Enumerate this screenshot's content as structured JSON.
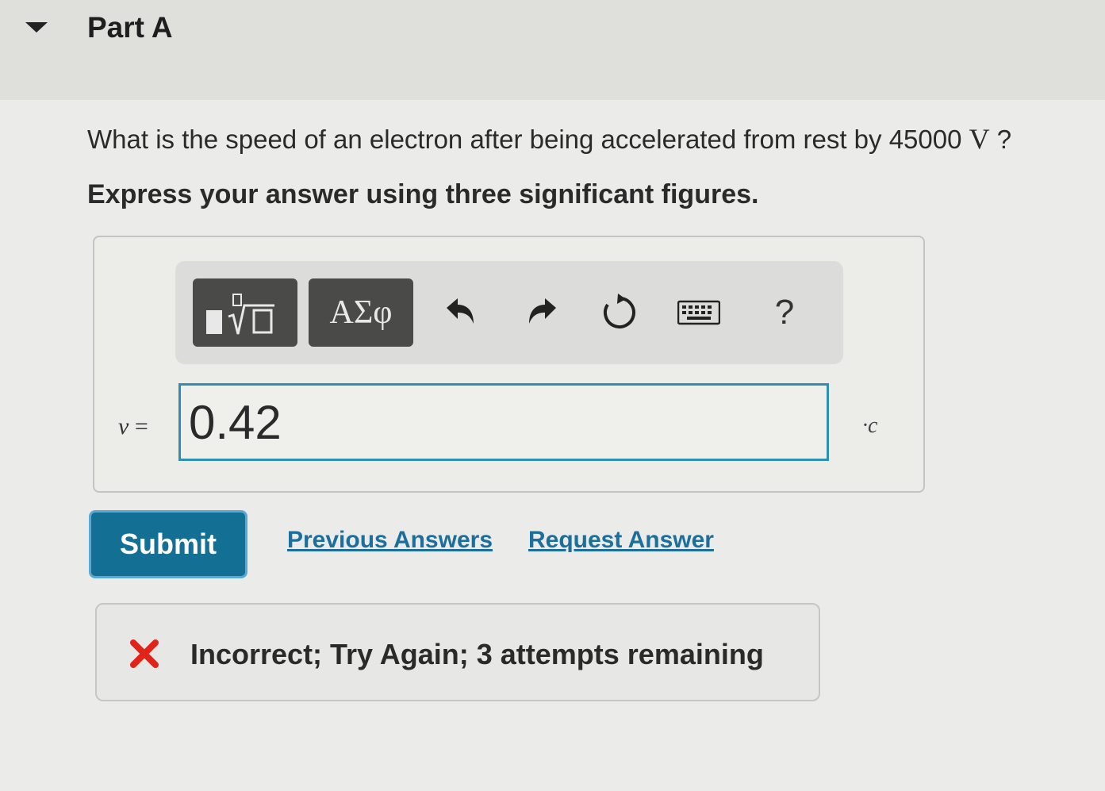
{
  "part": {
    "title": "Part A"
  },
  "question": {
    "prompt_prefix": "What is the speed of an electron after being accelerated from rest by 45000 ",
    "unit": "V",
    "prompt_suffix": " ?",
    "instruction": "Express your answer using three significant figures."
  },
  "toolbar": {
    "greek_label": "ΑΣφ",
    "help_label": "?"
  },
  "answer": {
    "variable": "v",
    "equals": " =",
    "value": "0.42",
    "units": "·c"
  },
  "actions": {
    "submit_label": "Submit",
    "previous_answers_label": "Previous Answers",
    "request_answer_label": "Request Answer"
  },
  "feedback": {
    "text": "Incorrect; Try Again; 3 attempts remaining",
    "status_color": "#e2231a"
  },
  "colors": {
    "accent": "#136f93",
    "input_border": "#2f8fb2",
    "link": "#1c6f9c"
  }
}
